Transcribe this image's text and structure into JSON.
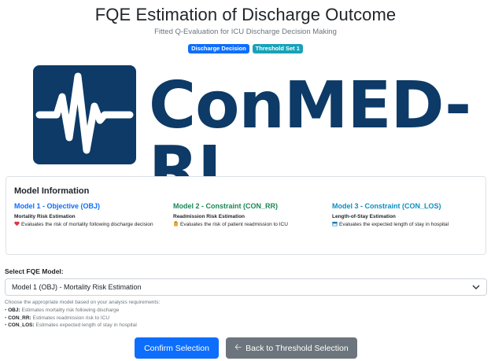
{
  "header": {
    "title": "FQE Estimation of Discharge Outcome",
    "subtitle": "Fitted Q-Evaluation for ICU Discharge Decision Making",
    "badges": [
      "Discharge Decision",
      "Threshold Set 1"
    ]
  },
  "logo": {
    "text": "ConMED-RL",
    "icon": "pulse-waveform-icon",
    "color": "#0d3a66"
  },
  "model_info": {
    "title": "Model Information",
    "models": [
      {
        "heading": "Model 1 - Objective (OBJ)",
        "subtitle": "Mortality Risk Estimation",
        "icon": "heart-icon",
        "description": "Evaluates the risk of mortality following discharge decision",
        "color": "#0d6efd"
      },
      {
        "heading": "Model 2 - Constraint (CON_RR)",
        "subtitle": "Readmission Risk Estimation",
        "icon": "clipboard-icon",
        "description": "Evaluates the risk of patient readmission to ICU",
        "color": "#198754"
      },
      {
        "heading": "Model 3 - Constraint (CON_LOS)",
        "subtitle": "Length-of-Stay Estimation",
        "icon": "calendar-icon",
        "description": "Evaluates the expected length of stay in hospital",
        "color": "#0a8fc2"
      }
    ]
  },
  "select": {
    "label": "Select FQE Model:",
    "value": "Model 1 (OBJ) - Mortality Risk Estimation"
  },
  "help": {
    "intro": "Choose the appropriate model based on your analysis requirements:",
    "items": [
      {
        "key": "OBJ:",
        "text": "Estimates mortality risk following discharge"
      },
      {
        "key": "CON_RR:",
        "text": "Estimates readmission risk to ICU"
      },
      {
        "key": "CON_LOS:",
        "text": "Estimates expected length of stay in hospital"
      }
    ]
  },
  "buttons": {
    "confirm": "Confirm Selection",
    "back": "Back to Threshold Selection"
  }
}
